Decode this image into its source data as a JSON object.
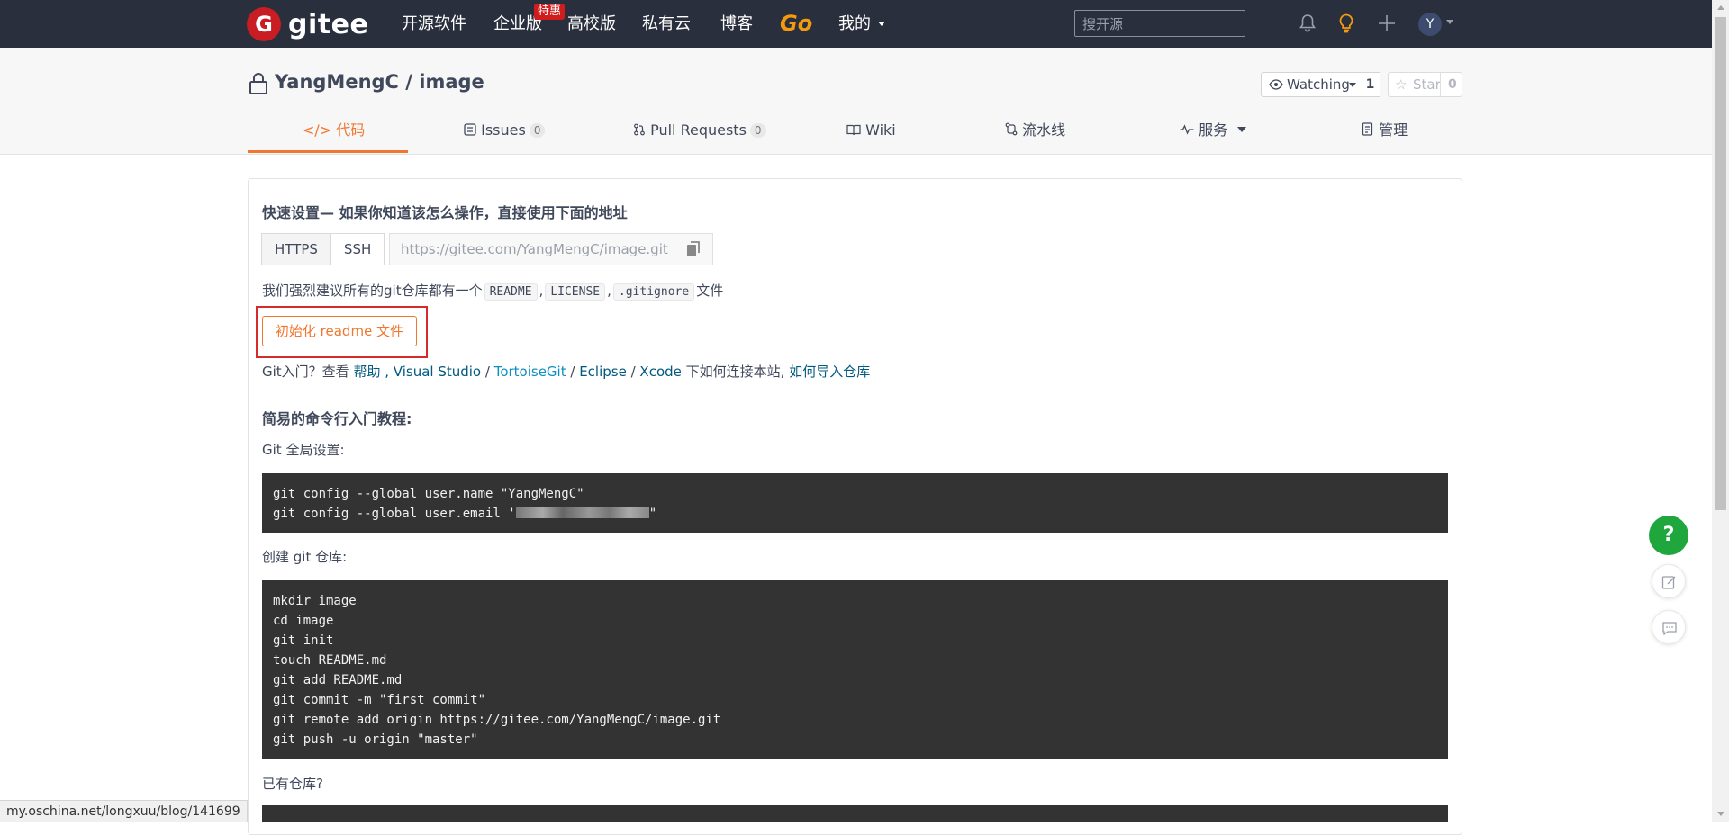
{
  "topnav": {
    "logo_text": "gitee",
    "logo_mark": "G",
    "items": [
      "开源软件",
      "企业版",
      "高校版",
      "私有云",
      "博客"
    ],
    "enterprise_badge": "特惠",
    "go_label": "Go",
    "mine_label": "我的",
    "search_placeholder": "搜开源",
    "avatar_initial": "Y",
    "icons": [
      "bell-icon",
      "lightbulb-icon",
      "plus-icon",
      "chevron-down-icon"
    ],
    "colors": {
      "bar": "#2a2f3d",
      "go": "#f29a10",
      "badge": "#d01c1c"
    }
  },
  "repo": {
    "title": "YangMengC / image",
    "watch_label": "Watching",
    "watch_count": "1",
    "star_label": "Star",
    "star_count": "0"
  },
  "tabs": [
    {
      "label": "代码",
      "icon": "code-icon",
      "active": true
    },
    {
      "label": "Issues",
      "count": "0",
      "icon": "issues-icon"
    },
    {
      "label": "Pull Requests",
      "count": "0",
      "icon": "pull-request-icon"
    },
    {
      "label": "Wiki",
      "icon": "book-icon"
    },
    {
      "label": "流水线",
      "icon": "pipeline-icon"
    },
    {
      "label": "服务",
      "icon": "pulse-icon",
      "has_dropdown": true
    },
    {
      "label": "管理",
      "icon": "settings-doc-icon"
    }
  ],
  "quick_setup": {
    "title": "快速设置— 如果你知道该怎么操作，直接使用下面的地址",
    "protocols": [
      "HTTPS",
      "SSH"
    ],
    "url_placeholder": "https://gitee.com/YangMengC/image.git",
    "recommend_prefix": "我们强烈建议所有的git仓库都有一个",
    "recommend_files": [
      "README",
      "LICENSE",
      ".gitignore"
    ],
    "recommend_sep": ",",
    "recommend_suffix": "文件",
    "init_button": "初始化 readme 文件",
    "help_prefix": "Git入门？查看 ",
    "help_link": "帮助",
    "help_sep1": " , ",
    "vs_link": "Visual Studio",
    "slash": " / ",
    "tortoise_link": "TortoiseGit",
    "eclipse_link": "Eclipse",
    "xcode_link": "Xcode",
    "connect_text": " 下如何连接本站, ",
    "import_link": "如何导入仓库"
  },
  "tutorial": {
    "title": "简易的命令行入门教程:",
    "global_label": "Git 全局设置:",
    "global_code": [
      "git config --global user.name \"YangMengC\"",
      "git config --global user.email '"
    ],
    "global_code_tail": "\"",
    "create_label": "创建 git 仓库:",
    "create_code": [
      "mkdir image",
      "cd image",
      "git init",
      "touch README.md",
      "git add README.md",
      "git commit -m \"first commit\"",
      "git remote add origin https://gitee.com/YangMengC/image.git",
      "git push -u origin \"master\""
    ],
    "existing_label": "已有仓库?"
  },
  "floating": {
    "help_label": "?",
    "icons": [
      "edit-icon",
      "chat-icon"
    ]
  },
  "status_bar": {
    "url": "my.oschina.net/longxuu/blog/141699"
  },
  "accent": "#f0772f"
}
